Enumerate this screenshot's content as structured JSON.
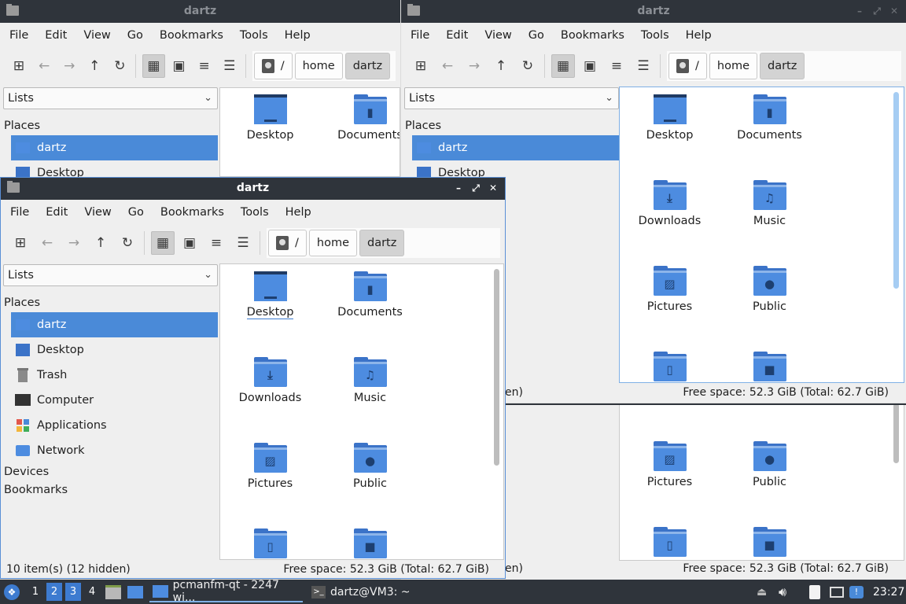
{
  "windows": [
    {
      "id": "top-left",
      "title": "dartz",
      "active": false,
      "menu": [
        "File",
        "Edit",
        "View",
        "Go",
        "Bookmarks",
        "Tools",
        "Help"
      ],
      "path": {
        "root": "/",
        "segments": [
          "home",
          "dartz"
        ]
      },
      "sidebar_mode": "Lists",
      "places_heading": "Places",
      "places": [
        {
          "label": "dartz",
          "icon": "home-icon",
          "selected": true
        },
        {
          "label": "Desktop",
          "icon": "desktop-icon",
          "selected": false
        }
      ],
      "files": [
        {
          "label": "Desktop",
          "icon": "desktop-folder-icon"
        },
        {
          "label": "Documents",
          "icon": "documents-folder-icon"
        }
      ]
    },
    {
      "id": "top-right",
      "title": "dartz",
      "active": false,
      "menu": [
        "File",
        "Edit",
        "View",
        "Go",
        "Bookmarks",
        "Tools",
        "Help"
      ],
      "path": {
        "root": "/",
        "segments": [
          "home",
          "dartz"
        ]
      },
      "sidebar_mode": "Lists",
      "places_heading": "Places",
      "places": [
        {
          "label": "dartz",
          "icon": "home-icon",
          "selected": true
        },
        {
          "label": "Desktop",
          "icon": "desktop-icon",
          "selected": false
        }
      ],
      "files": [
        {
          "label": "Desktop",
          "icon": "desktop-folder-icon"
        },
        {
          "label": "Documents",
          "icon": "documents-folder-icon"
        },
        {
          "label": "Downloads",
          "icon": "downloads-folder-icon"
        },
        {
          "label": "Music",
          "icon": "music-folder-icon"
        },
        {
          "label": "Pictures",
          "icon": "pictures-folder-icon"
        },
        {
          "label": "Public",
          "icon": "public-folder-icon"
        },
        {
          "label": "",
          "icon": "templates-folder-icon"
        },
        {
          "label": "",
          "icon": "videos-folder-icon"
        }
      ],
      "status_left_fragment": "en)",
      "status_right": "Free space: 52.3 GiB (Total: 62.7 GiB)"
    },
    {
      "id": "bottom-right",
      "files": [
        {
          "label": "Pictures",
          "icon": "pictures-folder-icon"
        },
        {
          "label": "Public",
          "icon": "public-folder-icon"
        },
        {
          "label": "",
          "icon": "templates-folder-icon"
        },
        {
          "label": "",
          "icon": "videos-folder-icon"
        }
      ],
      "status_left_fragment": "en)",
      "status_right": "Free space: 52.3 GiB (Total: 62.7 GiB)"
    },
    {
      "id": "front",
      "title": "dartz",
      "active": true,
      "window_buttons": [
        "–",
        "⤢",
        "✕"
      ],
      "menu": [
        "File",
        "Edit",
        "View",
        "Go",
        "Bookmarks",
        "Tools",
        "Help"
      ],
      "path": {
        "root": "/",
        "segments": [
          "home",
          "dartz"
        ]
      },
      "sidebar_mode": "Lists",
      "places_heading": "Places",
      "places": [
        {
          "label": "dartz",
          "icon": "home-icon",
          "selected": true
        },
        {
          "label": "Desktop",
          "icon": "desktop-icon",
          "selected": false
        },
        {
          "label": "Trash",
          "icon": "trash-icon",
          "selected": false
        },
        {
          "label": "Computer",
          "icon": "computer-icon",
          "selected": false
        },
        {
          "label": "Applications",
          "icon": "applications-icon",
          "selected": false
        },
        {
          "label": "Network",
          "icon": "network-icon",
          "selected": false
        }
      ],
      "devices_heading": "Devices",
      "bookmarks_heading": "Bookmarks",
      "files": [
        {
          "label": "Desktop",
          "icon": "desktop-folder-icon"
        },
        {
          "label": "Documents",
          "icon": "documents-folder-icon"
        },
        {
          "label": "Downloads",
          "icon": "downloads-folder-icon"
        },
        {
          "label": "Music",
          "icon": "music-folder-icon"
        },
        {
          "label": "Pictures",
          "icon": "pictures-folder-icon"
        },
        {
          "label": "Public",
          "icon": "public-folder-icon"
        },
        {
          "label": "",
          "icon": "templates-folder-icon"
        },
        {
          "label": "",
          "icon": "videos-folder-icon"
        }
      ],
      "status_left": "10 item(s) (12 hidden)",
      "status_right": "Free space: 52.3 GiB (Total: 62.7 GiB)"
    }
  ],
  "taskbar": {
    "workspaces": [
      "1",
      "2",
      "3",
      "4"
    ],
    "active_workspaces": [
      "2",
      "3"
    ],
    "tasks": [
      {
        "label": "pcmanfm-qt - 2247 wi...",
        "icon": "folder-icon",
        "active": true
      },
      {
        "label": "dartz@VM3: ~",
        "icon": "terminal-icon",
        "active": false
      }
    ],
    "clock": "23:27"
  },
  "colors": {
    "titlebar": "#2f343b",
    "selection": "#4a8ad8",
    "folder": "#4d8ce0",
    "taskbar": "#2f343b"
  }
}
